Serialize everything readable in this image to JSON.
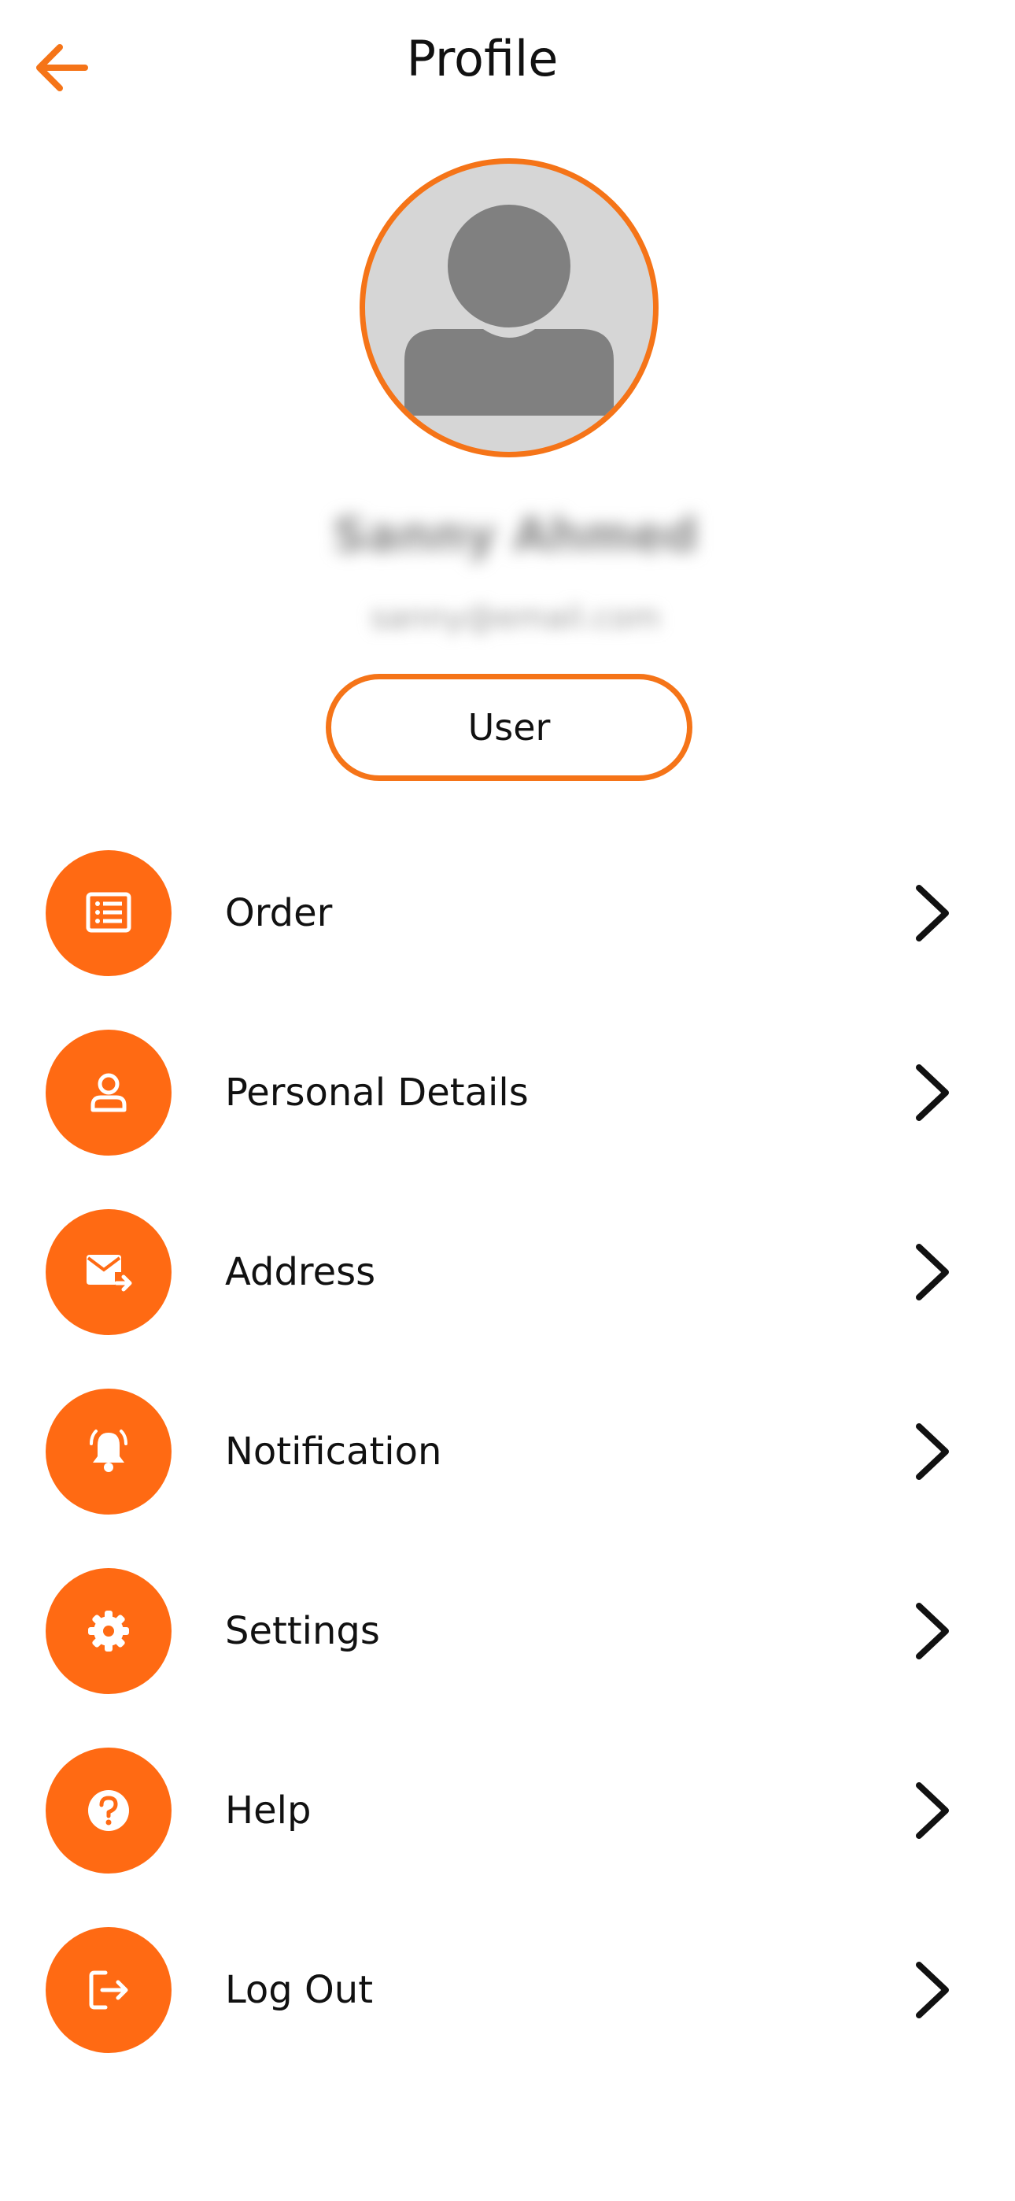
{
  "header": {
    "title": "Profile",
    "back_icon": "arrow-left-icon",
    "accent_color": "#f57418"
  },
  "profile": {
    "avatar_icon": "user-avatar-icon",
    "name": "Sanny Ahmed",
    "subtitle": "sanny@email.com",
    "role": "User"
  },
  "menu": {
    "icon_color": "#ff6a13",
    "items": [
      {
        "label": "Order",
        "icon": "list-icon"
      },
      {
        "label": "Personal Details",
        "icon": "person-icon"
      },
      {
        "label": "Address",
        "icon": "mail-forward-icon"
      },
      {
        "label": "Notification",
        "icon": "bell-icon"
      },
      {
        "label": "Settings",
        "icon": "gear-icon"
      },
      {
        "label": "Help",
        "icon": "question-icon"
      },
      {
        "label": "Log Out",
        "icon": "logout-icon"
      }
    ]
  }
}
